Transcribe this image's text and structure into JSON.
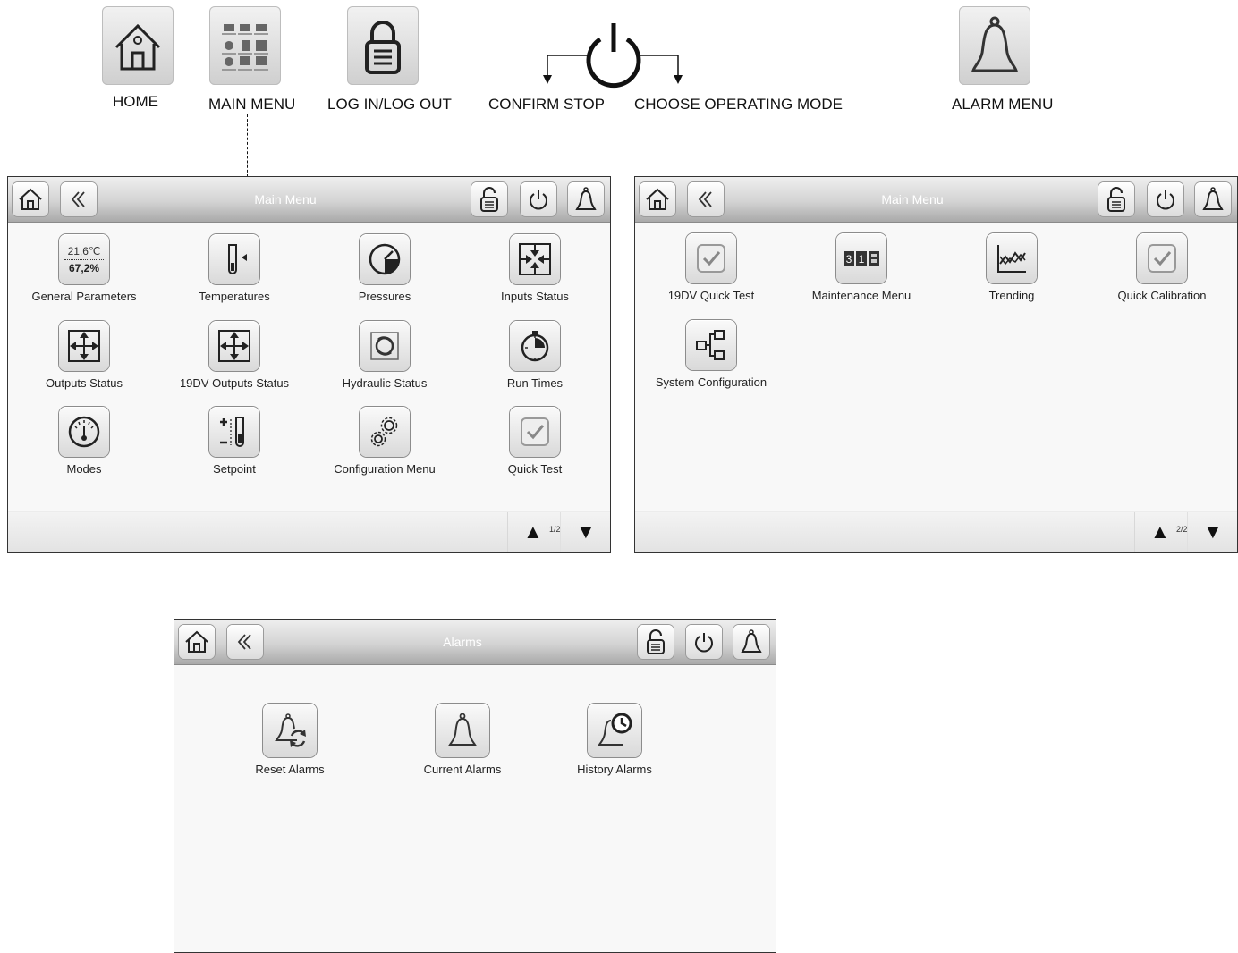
{
  "legend": {
    "home": "HOME",
    "main_menu": "MAIN MENU",
    "login": "LOG IN/LOG OUT",
    "confirm_stop": "CONFIRM STOP",
    "operating_mode": "CHOOSE OPERATING MODE",
    "alarm_menu": "ALARM MENU"
  },
  "panel1": {
    "title": "Main Menu",
    "page": "1/2",
    "items": [
      {
        "label": "General Parameters",
        "value_top": "21,6℃",
        "value_bottom": "67,2%"
      },
      {
        "label": "Temperatures"
      },
      {
        "label": "Pressures"
      },
      {
        "label": "Inputs Status"
      },
      {
        "label": "Outputs Status"
      },
      {
        "label": "19DV Outputs Status"
      },
      {
        "label": "Hydraulic Status"
      },
      {
        "label": "Run Times"
      },
      {
        "label": "Modes"
      },
      {
        "label": "Setpoint"
      },
      {
        "label": "Configuration Menu"
      },
      {
        "label": "Quick Test"
      }
    ]
  },
  "panel2": {
    "title": "Main Menu",
    "page": "2/2",
    "items": [
      {
        "label": "19DV Quick Test"
      },
      {
        "label": "Maintenance Menu"
      },
      {
        "label": "Trending"
      },
      {
        "label": "Quick Calibration"
      },
      {
        "label": "System Configuration"
      }
    ]
  },
  "panel3": {
    "title": "Alarms",
    "items": [
      {
        "label": "Reset Alarms"
      },
      {
        "label": "Current Alarms"
      },
      {
        "label": "History Alarms"
      }
    ]
  }
}
